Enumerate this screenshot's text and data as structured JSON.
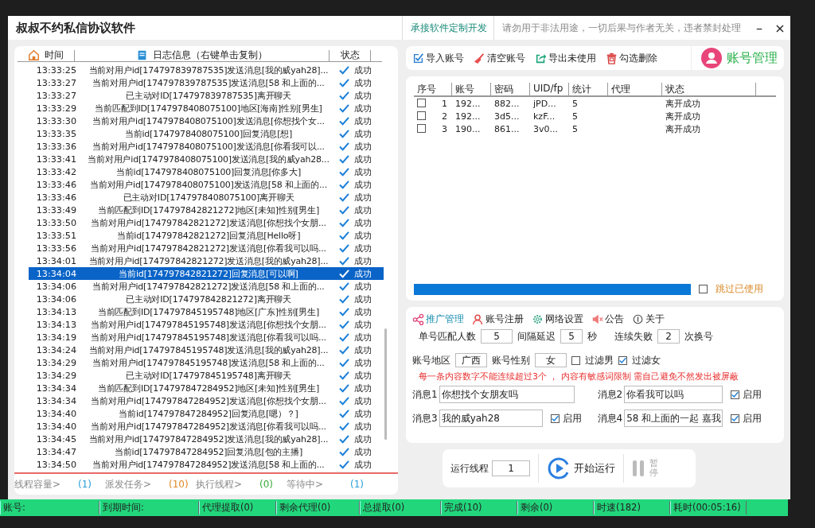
{
  "window": {
    "title": "叔叔不约私信协议软件",
    "link": "承接软件定制开发",
    "notice": "请勿用于非法用途，一切后果与作者无关，违者禁封处理",
    "minimize": "–",
    "close": "×"
  },
  "log": {
    "columns": [
      "时间",
      "日志信息（右键单击复制）",
      "状态"
    ],
    "rows": [
      {
        "time": "13:33:25",
        "message": "当前对用户id[174797839787535]发送消息[我的威yah28]...",
        "status": "成功",
        "selected": false
      },
      {
        "time": "13:33:27",
        "message": "当前对用户id[174797839787535]发送消息[58 和上面的...",
        "status": "成功",
        "selected": false
      },
      {
        "time": "13:33:27",
        "message": "已主动对ID[174797839787535]离开聊天",
        "status": "成功",
        "selected": false
      },
      {
        "time": "13:33:29",
        "message": "当前匹配到ID[1747978408075100]地区[海南]性别[男生]",
        "status": "成功",
        "selected": false
      },
      {
        "time": "13:33:30",
        "message": "当前对用户id[1747978408075100]发送消息[你想找个女...",
        "status": "成功",
        "selected": false
      },
      {
        "time": "13:33:35",
        "message": "当前id[1747978408075100]回复消息[想]",
        "status": "成功",
        "selected": false
      },
      {
        "time": "13:33:36",
        "message": "当前对用户id[1747978408075100]发送消息[你看我可以...",
        "status": "成功",
        "selected": false
      },
      {
        "time": "13:33:41",
        "message": "当前对用户id[1747978408075100]发送消息[我的威yah28...",
        "status": "成功",
        "selected": false
      },
      {
        "time": "13:33:42",
        "message": "当前id[1747978408075100]回复消息[你多大]",
        "status": "成功",
        "selected": false
      },
      {
        "time": "13:33:46",
        "message": "当前对用户id[1747978408075100]发送消息[58 和上面的...",
        "status": "成功",
        "selected": false
      },
      {
        "time": "13:33:46",
        "message": "已主动对ID[1747978408075100]离开聊天",
        "status": "成功",
        "selected": false
      },
      {
        "time": "13:33:49",
        "message": "当前匹配到ID[174797842821272]地区[未知]性别[男生]",
        "status": "成功",
        "selected": false
      },
      {
        "time": "13:33:50",
        "message": "当前对用户id[174797842821272]发送消息[你想找个女朋...",
        "status": "成功",
        "selected": false
      },
      {
        "time": "13:33:51",
        "message": "当前id[174797842821272]回复消息[Hello呀]",
        "status": "成功",
        "selected": false
      },
      {
        "time": "13:33:56",
        "message": "当前对用户id[174797842821272]发送消息[你看我可以吗...",
        "status": "成功",
        "selected": false
      },
      {
        "time": "13:34:01",
        "message": "当前对用户id[174797842821272]发送消息[我的威yah28]...",
        "status": "成功",
        "selected": false
      },
      {
        "time": "13:34:04",
        "message": "当前id[174797842821272]回复消息[可以啊]",
        "status": "成功",
        "selected": true
      },
      {
        "time": "13:34:06",
        "message": "当前对用户id[174797842821272]发送消息[58 和上面的...",
        "status": "成功",
        "selected": false
      },
      {
        "time": "13:34:06",
        "message": "已主动对ID[174797842821272]离开聊天",
        "status": "成功",
        "selected": false
      },
      {
        "time": "13:34:13",
        "message": "当前匹配到ID[174797845195748]地区[广东]性别[男生]",
        "status": "成功",
        "selected": false
      },
      {
        "time": "13:34:13",
        "message": "当前对用户id[174797845195748]发送消息[你想找个女朋...",
        "status": "成功",
        "selected": false
      },
      {
        "time": "13:34:19",
        "message": "当前对用户id[174797845195748]发送消息[你看我可以吗...",
        "status": "成功",
        "selected": false
      },
      {
        "time": "13:34:24",
        "message": "当前对用户id[174797845195748]发送消息[我的威yah28]...",
        "status": "成功",
        "selected": false
      },
      {
        "time": "13:34:29",
        "message": "当前对用户id[174797845195748]发送消息[58 和上面的...",
        "status": "成功",
        "selected": false
      },
      {
        "time": "13:34:29",
        "message": "已主动对ID[174797845195748]离开聊天",
        "status": "成功",
        "selected": false
      },
      {
        "time": "13:34:34",
        "message": "当前匹配到ID[174797847284952]地区[未知]性别[男生]",
        "status": "成功",
        "selected": false
      },
      {
        "time": "13:34:34",
        "message": "当前对用户id[174797847284952]发送消息[你想找个女朋...",
        "status": "成功",
        "selected": false
      },
      {
        "time": "13:34:40",
        "message": "当前id[174797847284952]回复消息[嗯）？]",
        "status": "成功",
        "selected": false
      },
      {
        "time": "13:34:40",
        "message": "当前对用户id[174797847284952]发送消息[你看我可以吗...",
        "status": "成功",
        "selected": false
      },
      {
        "time": "13:34:45",
        "message": "当前对用户id[174797847284952]发送消息[我的威yah28]...",
        "status": "成功",
        "selected": false
      },
      {
        "time": "13:34:47",
        "message": "当前id[174797847284952]回复消息[包的主播]",
        "status": "成功",
        "selected": false
      },
      {
        "time": "13:34:50",
        "message": "当前对用户id[174797847284952]发送消息[58 和上面的...",
        "status": "成功",
        "selected": false
      }
    ]
  },
  "counters": [
    {
      "label": "线程容量>",
      "value": "(1)",
      "color": "#2a9fd6"
    },
    {
      "label": "派发任务>",
      "value": "(10)",
      "color": "#e08a2a"
    },
    {
      "label": "执行线程>",
      "value": "(0)",
      "color": "#3aa83a"
    },
    {
      "label": "等待中>",
      "value": "(1)",
      "color": "#2a9fd6"
    }
  ],
  "accounts": {
    "toolbar": [
      {
        "label": "导入账号",
        "kind": "import"
      },
      {
        "label": "清空账号",
        "kind": "clear"
      },
      {
        "label": "导出未使用",
        "kind": "export"
      },
      {
        "label": "勾选删除",
        "kind": "delete"
      }
    ],
    "title": "账号管理",
    "columns": [
      "序号",
      "账号",
      "密码",
      "UID/fp",
      "统计",
      "代理",
      "状态"
    ],
    "rows": [
      {
        "checked": false,
        "no": "1",
        "account": "192...",
        "password": "882...",
        "uid": "jPD...",
        "stat": "5",
        "status": "离开成功"
      },
      {
        "checked": false,
        "no": "2",
        "account": "192...",
        "password": "3d5...",
        "uid": "kzF...",
        "stat": "5",
        "status": "离开成功"
      },
      {
        "checked": false,
        "no": "3",
        "account": "190...",
        "password": "861...",
        "uid": "3v0...",
        "stat": "5",
        "status": "离开成功"
      }
    ],
    "progress": {
      "level": 1
    },
    "skip_used": {
      "label": "跳过已使用",
      "checked": false
    }
  },
  "settings": {
    "tabs": [
      {
        "label": "推广管理",
        "kind": "share",
        "selected": true
      },
      {
        "label": "账号注册",
        "kind": "user",
        "selected": false
      },
      {
        "label": "网络设置",
        "kind": "gear",
        "selected": false
      },
      {
        "label": "公告",
        "kind": "speaker",
        "selected": false
      },
      {
        "label": "关于",
        "kind": "info",
        "selected": false
      }
    ],
    "match": [
      {
        "label": "单号匹配人数",
        "value": "5"
      },
      {
        "label": "间隔延迟",
        "value": "5",
        "unit": "秒"
      },
      {
        "label": "连续失败",
        "value": "2",
        "unit": "次换号"
      }
    ],
    "region": {
      "label": "账号地区",
      "value": "广西"
    },
    "gender": {
      "label": "账号性别",
      "value": "女"
    },
    "filters": [
      {
        "label": "过滤男",
        "checked": false
      },
      {
        "label": "过滤女",
        "checked": true
      }
    ],
    "warning": "每一条内容数字不能连续超过3个 ， 内容有敏感词限制 需自己避免不然发出被屏蔽",
    "messages": [
      {
        "label": "消息1",
        "value": "你想找个女朋友吗"
      },
      {
        "label": "消息2",
        "value": "你看我可以吗",
        "enable_label": "启用",
        "enabled": true
      },
      {
        "label": "消息3",
        "value": "我的威yah28",
        "enable_label": "启用",
        "enabled": true
      },
      {
        "label": "消息4",
        "value": "58 和上面的一起 嘉我",
        "enable_label": "启用",
        "enabled": true
      }
    ]
  },
  "run": {
    "threads_label": "运行线程",
    "threads": "1",
    "start": "开始运行",
    "pause": "暂停",
    "pause_disabled": true
  },
  "status_bar": [
    "账号:",
    "到期时间:",
    "代理提取(0)",
    "剩余代理(0)",
    "总提取(0)",
    "完成(10)",
    "剩余(0)",
    "时速(182)",
    "耗时(00:05:16)"
  ]
}
